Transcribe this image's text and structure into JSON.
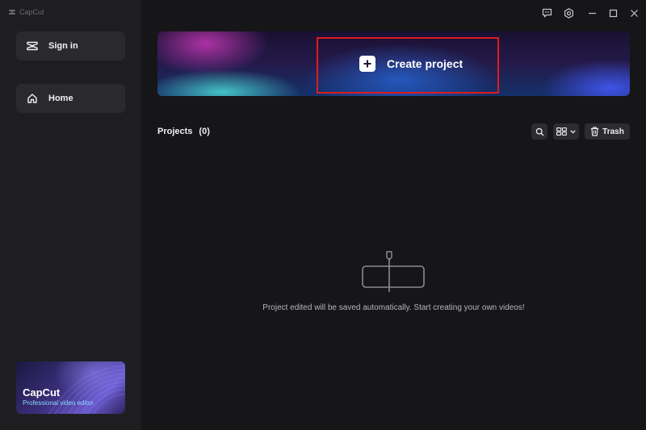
{
  "app": {
    "title": "CapCut"
  },
  "window_controls": {
    "feedback": "feedback-icon",
    "settings": "settings-icon",
    "minimize": "minimize-icon",
    "maximize": "maximize-icon",
    "close": "close-icon"
  },
  "sidebar": {
    "sign_in_label": "Sign in",
    "home_label": "Home",
    "promo": {
      "title": "CapCut",
      "subtitle": "Professional video editor"
    }
  },
  "main": {
    "create_project_label": "Create project",
    "projects_label": "Projects",
    "projects_count": "(0)",
    "trash_label": "Trash",
    "empty_message": "Project edited will be saved automatically. Start creating your own videos!"
  },
  "colors": {
    "background": "#161618",
    "sidebar": "#1e1e21",
    "button": "#2a2a2e",
    "highlight": "#e01b1b"
  }
}
